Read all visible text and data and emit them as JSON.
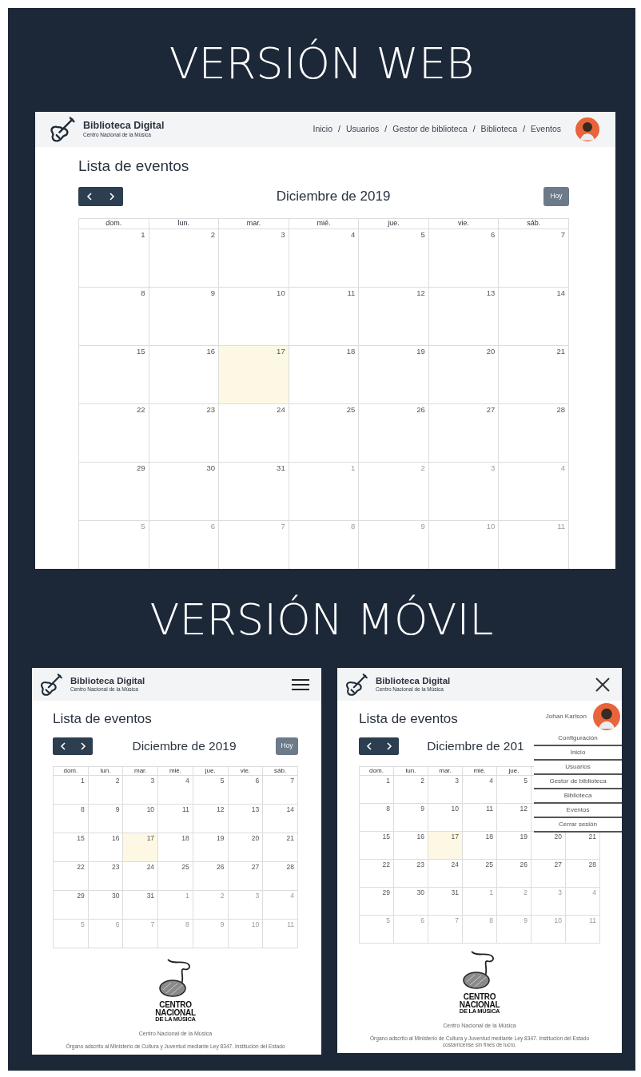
{
  "sections": [
    {
      "heading": "VERSIÓN WEB",
      "screens": [
        {
          "kind": "web",
          "brand": {
            "title": "Biblioteca Digital",
            "subtitle": "Centro Nacional de la Música"
          },
          "breadcrumbs": [
            {
              "kind": "link",
              "text": "Inicio"
            },
            {
              "kind": "separator",
              "text": "/"
            },
            {
              "kind": "link",
              "text": "Usuarios"
            },
            {
              "kind": "separator",
              "text": "/"
            },
            {
              "kind": "link",
              "text": "Gestor de biblioteca"
            },
            {
              "kind": "separator",
              "text": "/"
            },
            {
              "kind": "link",
              "text": "Biblioteca"
            },
            {
              "kind": "separator",
              "text": "/"
            },
            {
              "kind": "link",
              "text": "Eventos"
            }
          ],
          "title": "Lista de eventos",
          "month": "Diciembre de 2019",
          "today_button": "Hoy",
          "weekdays": [
            "dom.",
            "lun.",
            "mar.",
            "mié.",
            "jue.",
            "vie.",
            "sáb."
          ],
          "weeks": [
            [
              {
                "day": "1",
                "other_month": false,
                "today": false
              },
              {
                "day": "2",
                "other_month": false,
                "today": false
              },
              {
                "day": "3",
                "other_month": false,
                "today": false
              },
              {
                "day": "4",
                "other_month": false,
                "today": false
              },
              {
                "day": "5",
                "other_month": false,
                "today": false
              },
              {
                "day": "6",
                "other_month": false,
                "today": false
              },
              {
                "day": "7",
                "other_month": false,
                "today": false
              }
            ],
            [
              {
                "day": "8",
                "other_month": false,
                "today": false
              },
              {
                "day": "9",
                "other_month": false,
                "today": false
              },
              {
                "day": "10",
                "other_month": false,
                "today": false
              },
              {
                "day": "11",
                "other_month": false,
                "today": false
              },
              {
                "day": "12",
                "other_month": false,
                "today": false
              },
              {
                "day": "13",
                "other_month": false,
                "today": false
              },
              {
                "day": "14",
                "other_month": false,
                "today": false
              }
            ],
            [
              {
                "day": "15",
                "other_month": false,
                "today": false
              },
              {
                "day": "16",
                "other_month": false,
                "today": false
              },
              {
                "day": "17",
                "other_month": false,
                "today": true
              },
              {
                "day": "18",
                "other_month": false,
                "today": false
              },
              {
                "day": "19",
                "other_month": false,
                "today": false
              },
              {
                "day": "20",
                "other_month": false,
                "today": false
              },
              {
                "day": "21",
                "other_month": false,
                "today": false
              }
            ],
            [
              {
                "day": "22",
                "other_month": false,
                "today": false
              },
              {
                "day": "23",
                "other_month": false,
                "today": false
              },
              {
                "day": "24",
                "other_month": false,
                "today": false
              },
              {
                "day": "25",
                "other_month": false,
                "today": false
              },
              {
                "day": "26",
                "other_month": false,
                "today": false
              },
              {
                "day": "27",
                "other_month": false,
                "today": false
              },
              {
                "day": "28",
                "other_month": false,
                "today": false
              }
            ],
            [
              {
                "day": "29",
                "other_month": false,
                "today": false
              },
              {
                "day": "30",
                "other_month": false,
                "today": false
              },
              {
                "day": "31",
                "other_month": false,
                "today": false
              },
              {
                "day": "1",
                "other_month": true,
                "today": false
              },
              {
                "day": "2",
                "other_month": true,
                "today": false
              },
              {
                "day": "3",
                "other_month": true,
                "today": false
              },
              {
                "day": "4",
                "other_month": true,
                "today": false
              }
            ],
            [
              {
                "day": "5",
                "other_month": true,
                "today": false
              },
              {
                "day": "6",
                "other_month": true,
                "today": false
              },
              {
                "day": "7",
                "other_month": true,
                "today": false
              },
              {
                "day": "8",
                "other_month": true,
                "today": false
              },
              {
                "day": "9",
                "other_month": true,
                "today": false
              },
              {
                "day": "10",
                "other_month": true,
                "today": false
              },
              {
                "day": "11",
                "other_month": true,
                "today": false
              }
            ]
          ]
        }
      ]
    },
    {
      "heading": "VERSIÓN MÓVIL",
      "screens": [
        {
          "kind": "mobile",
          "toggle": {
            "kind": "menu"
          },
          "brand": {
            "title": "Biblioteca Digital",
            "subtitle": "Centro Nacional de la Música"
          },
          "title": "Lista de eventos",
          "month": "Diciembre de 2019",
          "today_button": "Hoy",
          "weekdays": [
            "dom.",
            "lun.",
            "mar.",
            "mié.",
            "jue.",
            "vie.",
            "sáb."
          ],
          "weeks": [
            [
              {
                "day": "1",
                "other_month": false,
                "today": false
              },
              {
                "day": "2",
                "other_month": false,
                "today": false
              },
              {
                "day": "3",
                "other_month": false,
                "today": false
              },
              {
                "day": "4",
                "other_month": false,
                "today": false
              },
              {
                "day": "5",
                "other_month": false,
                "today": false
              },
              {
                "day": "6",
                "other_month": false,
                "today": false
              },
              {
                "day": "7",
                "other_month": false,
                "today": false
              }
            ],
            [
              {
                "day": "8",
                "other_month": false,
                "today": false
              },
              {
                "day": "9",
                "other_month": false,
                "today": false
              },
              {
                "day": "10",
                "other_month": false,
                "today": false
              },
              {
                "day": "11",
                "other_month": false,
                "today": false
              },
              {
                "day": "12",
                "other_month": false,
                "today": false
              },
              {
                "day": "13",
                "other_month": false,
                "today": false
              },
              {
                "day": "14",
                "other_month": false,
                "today": false
              }
            ],
            [
              {
                "day": "15",
                "other_month": false,
                "today": false
              },
              {
                "day": "16",
                "other_month": false,
                "today": false
              },
              {
                "day": "17",
                "other_month": false,
                "today": true
              },
              {
                "day": "18",
                "other_month": false,
                "today": false
              },
              {
                "day": "19",
                "other_month": false,
                "today": false
              },
              {
                "day": "20",
                "other_month": false,
                "today": false
              },
              {
                "day": "21",
                "other_month": false,
                "today": false
              }
            ],
            [
              {
                "day": "22",
                "other_month": false,
                "today": false
              },
              {
                "day": "23",
                "other_month": false,
                "today": false
              },
              {
                "day": "24",
                "other_month": false,
                "today": false
              },
              {
                "day": "25",
                "other_month": false,
                "today": false
              },
              {
                "day": "26",
                "other_month": false,
                "today": false
              },
              {
                "day": "27",
                "other_month": false,
                "today": false
              },
              {
                "day": "28",
                "other_month": false,
                "today": false
              }
            ],
            [
              {
                "day": "29",
                "other_month": false,
                "today": false
              },
              {
                "day": "30",
                "other_month": false,
                "today": false
              },
              {
                "day": "31",
                "other_month": false,
                "today": false
              },
              {
                "day": "1",
                "other_month": true,
                "today": false
              },
              {
                "day": "2",
                "other_month": true,
                "today": false
              },
              {
                "day": "3",
                "other_month": true,
                "today": false
              },
              {
                "day": "4",
                "other_month": true,
                "today": false
              }
            ],
            [
              {
                "day": "5",
                "other_month": true,
                "today": false
              },
              {
                "day": "6",
                "other_month": true,
                "today": false
              },
              {
                "day": "7",
                "other_month": true,
                "today": false
              },
              {
                "day": "8",
                "other_month": true,
                "today": false
              },
              {
                "day": "9",
                "other_month": true,
                "today": false
              },
              {
                "day": "10",
                "other_month": true,
                "today": false
              },
              {
                "day": "11",
                "other_month": true,
                "today": false
              }
            ]
          ],
          "footer": {
            "logo_lines": [
              "CENTRO",
              "NACIONAL",
              "DE LA MÚSICA"
            ],
            "caption": "Centro Nacional de la Música",
            "note": "Órgano adscrito al Ministerio de Cultura y Juventud mediante Ley 8347. Institución del Estado"
          }
        },
        {
          "kind": "mobile",
          "toggle": {
            "kind": "close"
          },
          "brand": {
            "title": "Biblioteca Digital",
            "subtitle": "Centro Nacional de la Música"
          },
          "title": "Lista de eventos",
          "month": "Diciembre de 201",
          "weekdays": [
            "dom.",
            "lun.",
            "mar.",
            "mié.",
            "jue."
          ],
          "weeks": [
            [
              {
                "day": "1",
                "other_month": false,
                "today": false
              },
              {
                "day": "2",
                "other_month": false,
                "today": false
              },
              {
                "day": "3",
                "other_month": false,
                "today": false
              },
              {
                "day": "4",
                "other_month": false,
                "today": false
              },
              {
                "day": "5",
                "other_month": false,
                "today": false
              }
            ],
            [
              {
                "day": "8",
                "other_month": false,
                "today": false
              },
              {
                "day": "9",
                "other_month": false,
                "today": false
              },
              {
                "day": "10",
                "other_month": false,
                "today": false
              },
              {
                "day": "11",
                "other_month": false,
                "today": false
              },
              {
                "day": "12",
                "other_month": false,
                "today": false
              }
            ],
            [
              {
                "day": "15",
                "other_month": false,
                "today": false
              },
              {
                "day": "16",
                "other_month": false,
                "today": false
              },
              {
                "day": "17",
                "other_month": false,
                "today": true
              },
              {
                "day": "18",
                "other_month": false,
                "today": false
              },
              {
                "day": "19",
                "other_month": false,
                "today": false
              },
              {
                "day": "20",
                "other_month": false,
                "today": false
              },
              {
                "day": "21",
                "other_month": false,
                "today": false
              }
            ],
            [
              {
                "day": "22",
                "other_month": false,
                "today": false
              },
              {
                "day": "23",
                "other_month": false,
                "today": false
              },
              {
                "day": "24",
                "other_month": false,
                "today": false
              },
              {
                "day": "25",
                "other_month": false,
                "today": false
              },
              {
                "day": "26",
                "other_month": false,
                "today": false
              },
              {
                "day": "27",
                "other_month": false,
                "today": false
              },
              {
                "day": "28",
                "other_month": false,
                "today": false
              }
            ],
            [
              {
                "day": "29",
                "other_month": false,
                "today": false
              },
              {
                "day": "30",
                "other_month": false,
                "today": false
              },
              {
                "day": "31",
                "other_month": false,
                "today": false
              },
              {
                "day": "1",
                "other_month": true,
                "today": false
              },
              {
                "day": "2",
                "other_month": true,
                "today": false
              },
              {
                "day": "3",
                "other_month": true,
                "today": false
              },
              {
                "day": "4",
                "other_month": true,
                "today": false
              }
            ],
            [
              {
                "day": "5",
                "other_month": true,
                "today": false
              },
              {
                "day": "6",
                "other_month": true,
                "today": false
              },
              {
                "day": "7",
                "other_month": true,
                "today": false
              },
              {
                "day": "8",
                "other_month": true,
                "today": false
              },
              {
                "day": "9",
                "other_month": true,
                "today": false
              },
              {
                "day": "10",
                "other_month": true,
                "today": false
              },
              {
                "day": "11",
                "other_month": true,
                "today": false
              }
            ]
          ],
          "menu": {
            "user": "Johan Karlson",
            "items": [
              "Configuración",
              "Inicio",
              "Usuarios",
              "Gestor de biblioteca",
              "Biblioteca",
              "Eventos",
              "Cerrar sesión"
            ]
          },
          "footer": {
            "logo_lines": [
              "CENTRO",
              "NACIONAL",
              "DE LA MÚSICA"
            ],
            "caption": "Centro Nacional de la Música",
            "note": "Órgano adscrito al Ministerio de Cultura y Juventud mediante Ley 8347. Institución del Estado costarricense sin fines de lucro."
          }
        }
      ]
    }
  ]
}
